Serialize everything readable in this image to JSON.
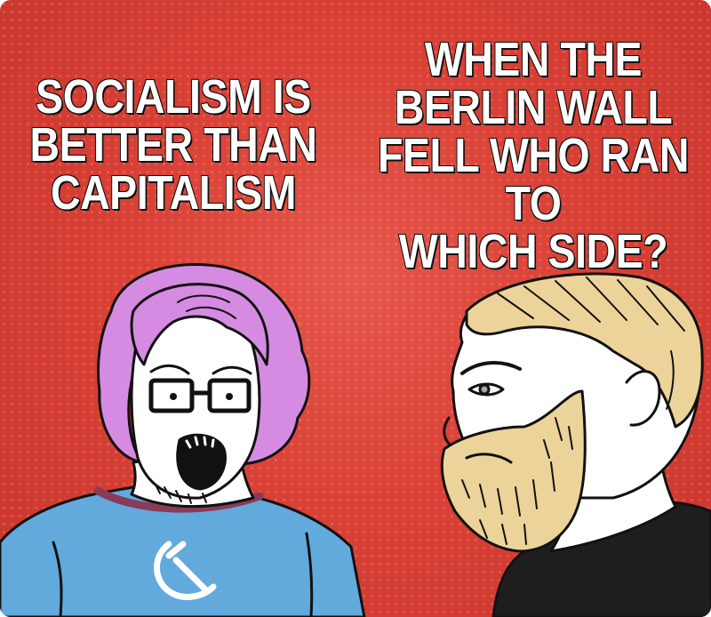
{
  "meme": {
    "left_caption": "SOCIALISM IS\nBETTER THAN\nCAPITALISM",
    "right_caption": "WHEN THE\nBERLIN WALL\nFELL WHO RAN TO\nWHICH SIDE?"
  },
  "colors": {
    "background": "#da4136",
    "left_hair": "#d68be2",
    "left_shirt": "#62a9dc",
    "right_hair": "#ecd399",
    "right_shirt": "#1e1e1e"
  },
  "icons": {
    "shirt_emblem": "hammer-and-sickle-icon"
  }
}
